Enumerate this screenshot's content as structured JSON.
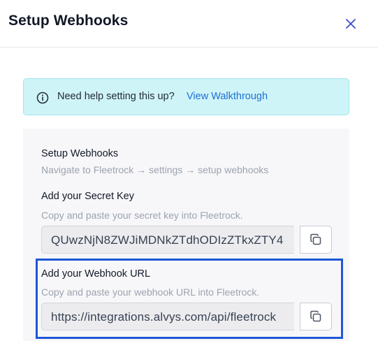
{
  "header": {
    "title": "Setup Webhooks",
    "close_icon": "close-icon"
  },
  "help_banner": {
    "text": "Need help setting this up?",
    "link_label": "View Walkthrough",
    "icon": "info-icon"
  },
  "steps": {
    "setup": {
      "title": "Setup Webhooks",
      "description": "Navigate to Fleetrock → settings → setup webhooks"
    },
    "secret_key": {
      "title": "Add your Secret Key",
      "description": "Copy and paste your secret key into Fleetrock.",
      "value": "QUwzNjN8ZWJiMDNkZTdhODIzZTkxZTY4",
      "copy_icon": "copy-icon"
    },
    "webhook_url": {
      "title": "Add your Webhook URL",
      "description": "Copy and paste your webhook URL into Fleetrock.",
      "value": "https://integrations.alvys.com/api/fleetrock",
      "copy_icon": "copy-icon"
    }
  },
  "colors": {
    "accent": "#1e57d6",
    "link": "#1d6fd6",
    "banner_bg": "#cff4f8"
  }
}
